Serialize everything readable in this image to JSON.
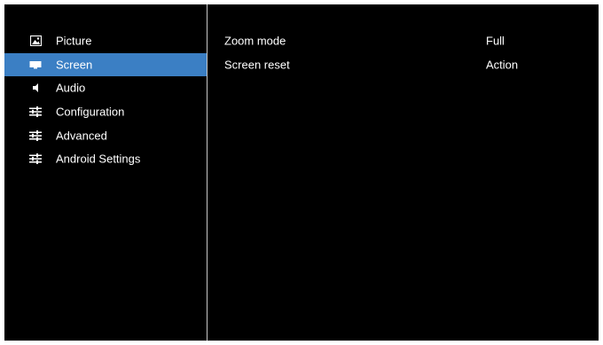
{
  "sidebar": {
    "items": [
      {
        "label": "Picture",
        "icon": "picture-icon",
        "selected": false
      },
      {
        "label": "Screen",
        "icon": "screen-icon",
        "selected": true
      },
      {
        "label": "Audio",
        "icon": "speaker-icon",
        "selected": false
      },
      {
        "label": "Configuration",
        "icon": "sliders-icon",
        "selected": false
      },
      {
        "label": "Advanced",
        "icon": "sliders-icon",
        "selected": false
      },
      {
        "label": "Android Settings",
        "icon": "sliders-icon",
        "selected": false
      }
    ]
  },
  "settings": {
    "rows": [
      {
        "label": "Zoom mode",
        "value": "Full"
      },
      {
        "label": "Screen reset",
        "value": "Action"
      }
    ]
  },
  "colors": {
    "background": "#000000",
    "selected": "#3b7fc4",
    "text": "#ffffff",
    "divider": "#c8c8c8"
  }
}
